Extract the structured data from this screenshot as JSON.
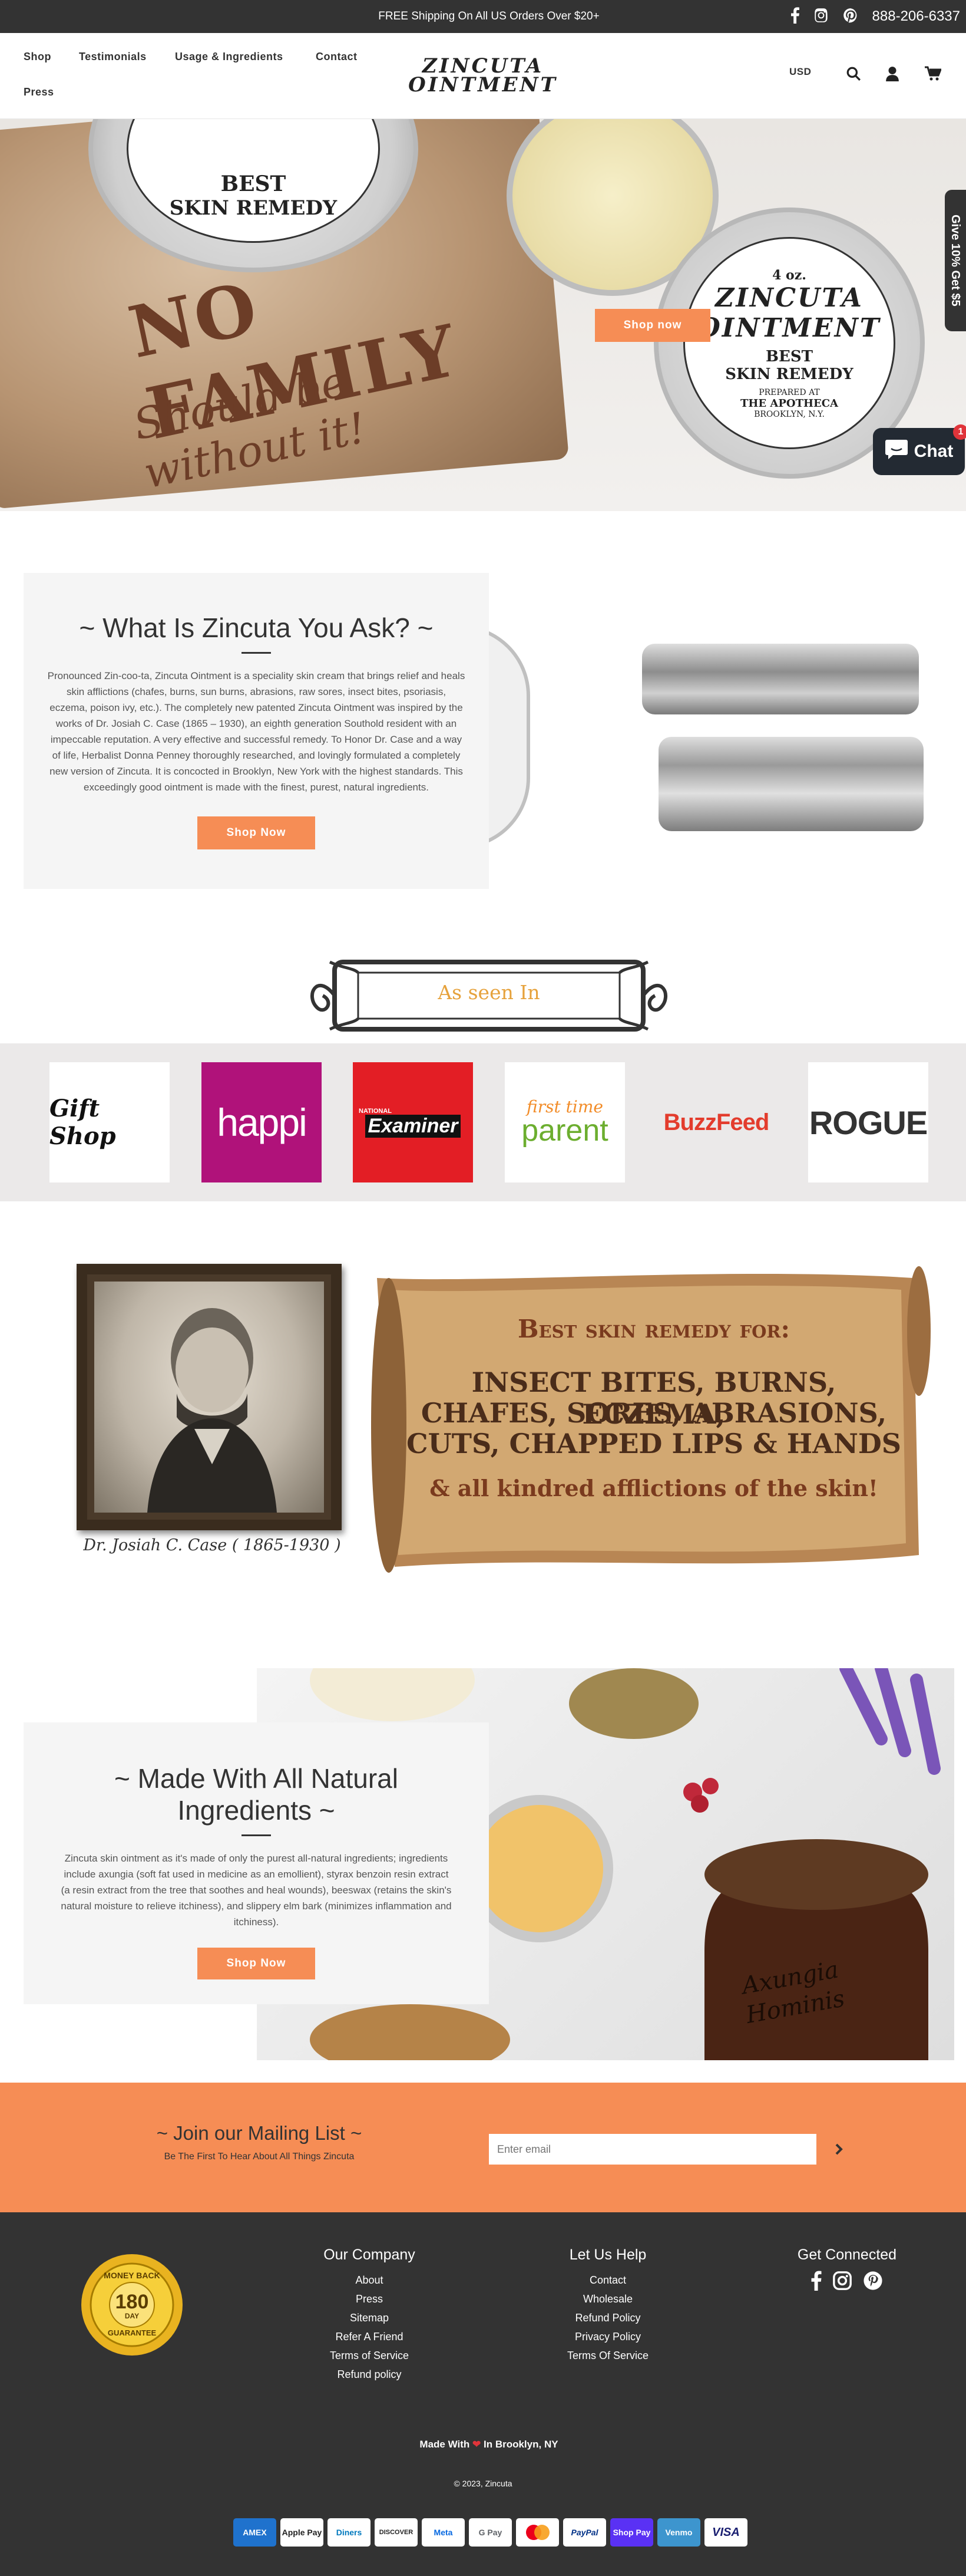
{
  "announcement": {
    "text": "FREE Shipping On All US Orders Over $20+",
    "phone": "888-206-6337"
  },
  "header": {
    "nav": [
      "Shop",
      "Testimonials",
      "Usage & Ingredients",
      "Contact",
      "Press"
    ],
    "logo_line1": "ZINCUTA",
    "logo_line2": "OINTMENT",
    "currency": "USD"
  },
  "hero": {
    "headline": "NO FAMILY",
    "subline": "Should be without it!",
    "tin_size": "4 oz.",
    "tin_brand1": "ZINCUTA",
    "tin_brand2": "OINTMENT",
    "tin_remedy1": "BEST",
    "tin_remedy2": "SKIN REMEDY",
    "tin_prepared": "PREPARED AT",
    "tin_apotheca": "THE APOTHECA",
    "tin_city": "BROOKLYN, N.Y.",
    "shop_button": "Shop now",
    "side_tab": "Give 10% Get $5",
    "chat_label": "Chat",
    "chat_badge": "1"
  },
  "what": {
    "title": "~ What Is Zincuta You Ask? ~",
    "text": "Pronounced Zin-coo-ta, Zincuta Ointment is a speciality skin cream that brings relief and heals skin afflictions (chafes, burns, sun burns, abrasions, raw sores, insect bites, psoriasis, eczema, poison ivy, etc.). The completely new patented Zincuta Ointment was inspired by the works of Dr. Josiah C. Case (1865 – 1930), an eighth generation Southold resident with an impeccable reputation. A very effective and successful remedy. To Honor Dr. Case and a way of life, Herbalist Donna Penney thoroughly researched, and lovingly formulated a completely new version of Zincuta. It is concocted in Brooklyn, New York with the highest standards. This exceedingly good ointment is made with the finest, purest, natural ingredients.",
    "button": "Shop Now"
  },
  "seen": {
    "title": "As seen In",
    "logos": [
      "Gift Shop",
      "happi",
      "Examiner",
      "first time",
      "parent",
      "BuzzFeed",
      "ROGUE"
    ],
    "examiner_small": "NATIONAL"
  },
  "remedy": {
    "caption": "Dr. Josiah C. Case ( 1865-1930 )",
    "heading": "Best skin remedy for:",
    "line1": "INSECT BITES, BURNS, ECZEMA,",
    "line2": "CHAFES, SORES, ABRASIONS,",
    "line3": "CUTS, CHAPPED LIPS & HANDS",
    "footer": "& all kindred afflictions of the skin!"
  },
  "natural": {
    "title": "~ Made With All Natural Ingredients ~",
    "text": "Zincuta skin ointment as it's made of only the purest all-natural ingredients; ingredients include axungia (soft fat used in medicine as an emollient), styrax benzoin resin extract (a resin extract from the tree that soothes and heal wounds), beeswax (retains the skin's natural moisture to relieve itchiness), and slippery elm bark (minimizes inflammation and itchiness).",
    "button": "Shop Now",
    "jar_label1": "Axungia",
    "jar_label2": "Hominis"
  },
  "mailing": {
    "title": "~ Join our Mailing List ~",
    "subtitle": "Be The First To Hear About All Things Zincuta",
    "placeholder": "Enter email"
  },
  "footer": {
    "badge_top": "MONEY BACK",
    "badge_num": "180",
    "badge_day": "DAY",
    "badge_bottom": "GUARANTEE",
    "company_title": "Our Company",
    "company_links": [
      "About",
      "Press",
      "Sitemap",
      "Refer A Friend",
      "Terms of Service",
      "Refund policy"
    ],
    "help_title": "Let Us Help",
    "help_links": [
      "Contact",
      "Wholesale",
      "Refund Policy",
      "Privacy Policy",
      "Terms Of Service"
    ],
    "connect_title": "Get Connected",
    "made_with_pre": "Made With",
    "made_with_post": "In Brooklyn, NY",
    "copyright": "© 2023, Zincuta",
    "payments": [
      "AMEX",
      "Apple Pay",
      "Diners",
      "DISCOVER",
      "Meta",
      "G Pay",
      "Mastercard",
      "PayPal",
      "Shop Pay",
      "Venmo",
      "VISA"
    ]
  },
  "colors": {
    "accent": "#f68d55",
    "dark": "#333333",
    "gold": "#e6a23c"
  }
}
